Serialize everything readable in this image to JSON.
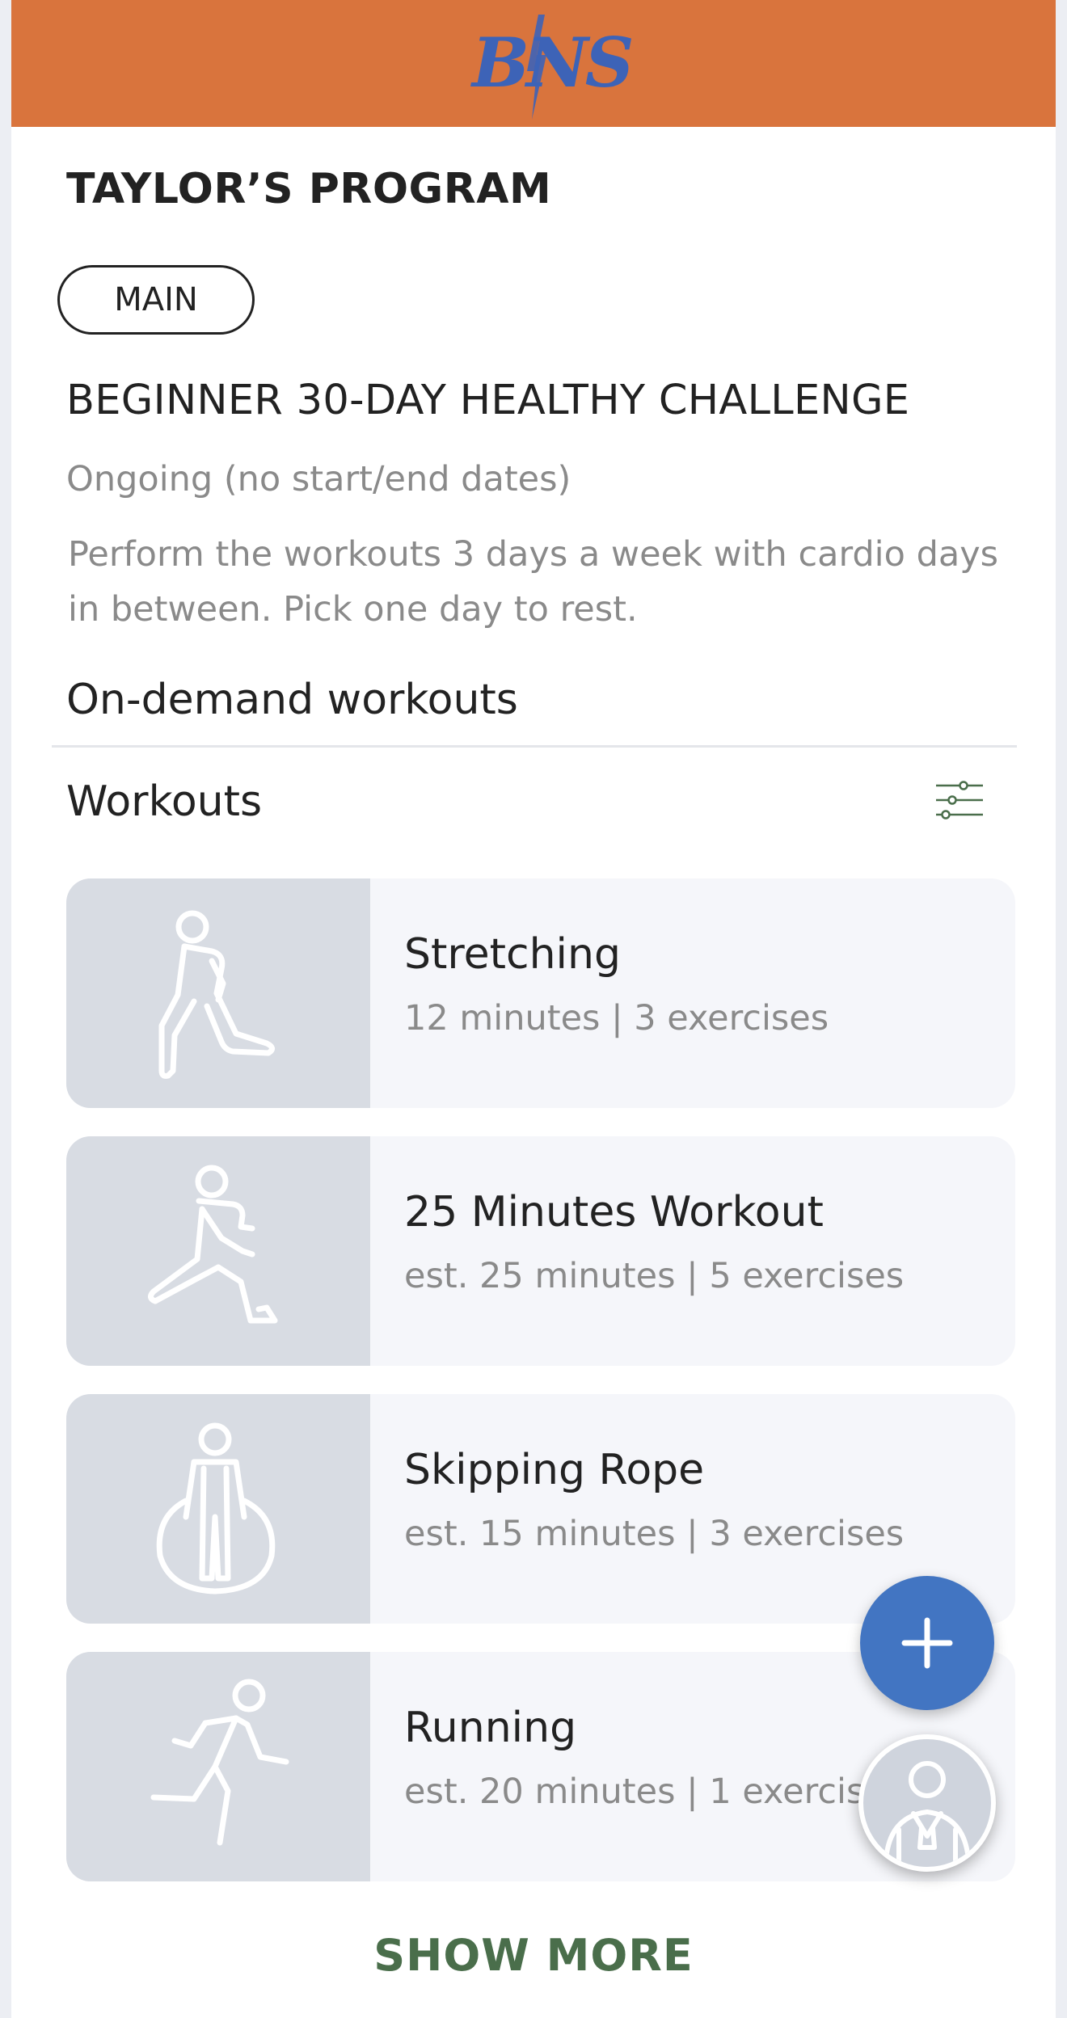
{
  "header": {
    "logo_text": "BNS",
    "background_color": "#d9743d",
    "logo_color": "#3d63b7"
  },
  "program": {
    "title": "TAYLOR’S PROGRAM",
    "tag": "MAIN",
    "challenge_title": "BEGINNER 30-DAY HEALTHY CHALLENGE",
    "dates": "Ongoing (no start/end dates)",
    "description": "Perform the workouts 3 days a week with cardio days in between. Pick one day to rest."
  },
  "sections": {
    "on_demand": "On-demand workouts",
    "workouts": "Workouts",
    "filter_icon": "sliders-icon"
  },
  "workouts": [
    {
      "title": "Stretching",
      "meta": "12 minutes | 3 exercises",
      "icon": "stretching-icon"
    },
    {
      "title": "25 Minutes Workout",
      "meta": "est. 25 minutes | 5 exercises",
      "icon": "lunge-icon"
    },
    {
      "title": "Skipping Rope",
      "meta": "est. 15 minutes | 3 exercises",
      "icon": "jump-rope-icon"
    },
    {
      "title": "Running",
      "meta": "est. 20 minutes | 1 exercise",
      "icon": "running-icon"
    }
  ],
  "show_more": "SHOW MORE",
  "fab": {
    "add_icon": "plus-icon",
    "coach_icon": "coach-avatar-icon",
    "accent_color": "#4275c2"
  },
  "colors": {
    "show_more": "#4a6e4b",
    "card_bg": "#f5f6fa",
    "thumb_bg": "#d8dce3"
  }
}
